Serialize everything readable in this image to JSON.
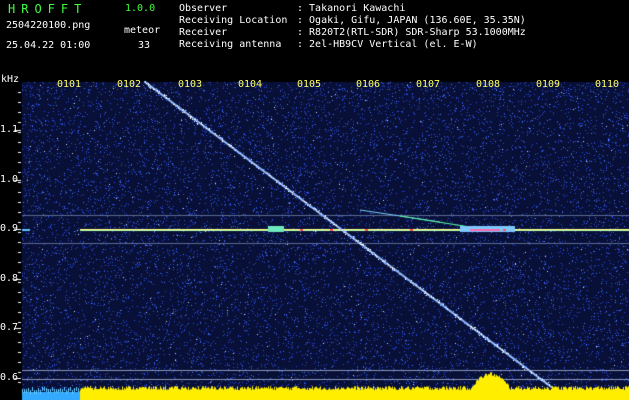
{
  "app": {
    "name": "HROFFT",
    "version": "1.0.0"
  },
  "capture": {
    "filename": "2504220100.png",
    "datetime": "25.04.22 01:00",
    "count_label": "meteor",
    "count_value": "33"
  },
  "info": [
    {
      "label": "Observer",
      "value": ": Takanori Kawachi"
    },
    {
      "label": "Receiving Location",
      "value": ": Ogaki, Gifu, JAPAN (136.60E, 35.35N)"
    },
    {
      "label": "Receiver",
      "value": ": R820T2(RTL-SDR) SDR-Sharp 53.1000MHz"
    },
    {
      "label": "Receiving antenna",
      "value": ": 2el-HB9CV Vertical (el. E-W)"
    }
  ],
  "axis": {
    "unit": "kHz",
    "x_ticks": [
      "0101",
      "0102",
      "0103",
      "0104",
      "0105",
      "0106",
      "0107",
      "0108",
      "0109",
      "0110"
    ],
    "y_ticks": [
      "1.1",
      "1.0",
      "0.9",
      "0.8",
      "0.7",
      "0.6"
    ]
  },
  "colors": {
    "background": "#000000",
    "spectrogram_base": "#081038",
    "noise": "#2a4ad8",
    "title_green": "#3cff3c",
    "tick_yellow": "#ffff66",
    "carrier": "#ffff80",
    "meteor_trace": "#9cc4ff",
    "bottom_bar": "#ffee00"
  }
}
